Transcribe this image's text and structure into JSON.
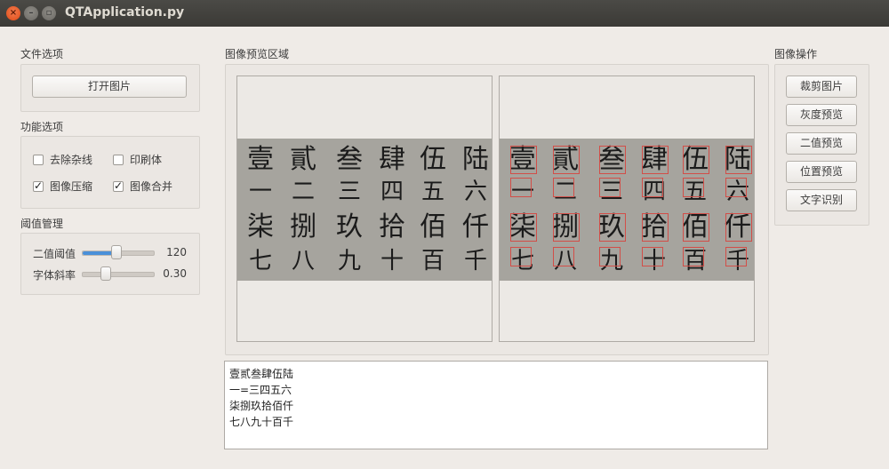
{
  "window": {
    "title": "QTApplication.py",
    "close_glyph": "×",
    "min_glyph": "–",
    "max_glyph": "▫"
  },
  "file_options": {
    "label": "文件选项",
    "open_button": "打开图片"
  },
  "function_options": {
    "label": "功能选项",
    "checkboxes": [
      {
        "label": "去除杂线",
        "checked": false
      },
      {
        "label": "印刷体",
        "checked": false
      },
      {
        "label": "图像压缩",
        "checked": true
      },
      {
        "label": "图像合并",
        "checked": true
      }
    ]
  },
  "threshold": {
    "label": "阈值管理",
    "sliders": [
      {
        "label": "二值阈值",
        "value_text": "120",
        "fraction": 0.47
      },
      {
        "label": "字体斜率",
        "value_text": "0.30",
        "fraction": 0.3
      }
    ]
  },
  "preview": {
    "label": "图像预览区域",
    "rows": [
      [
        "壹",
        "貳",
        "叁",
        "肆",
        "伍",
        "陆"
      ],
      [
        "一",
        "二",
        "三",
        "四",
        "五",
        "六"
      ],
      [
        "柒",
        "捌",
        "玖",
        "拾",
        "佰",
        "仟"
      ],
      [
        "七",
        "八",
        "九",
        "十",
        "百",
        "千"
      ]
    ]
  },
  "ocr_result": {
    "lines": [
      "壹贰叁肆伍陆",
      "一=三四五六",
      "柒捌玖拾佰仟",
      "七八九十百千"
    ]
  },
  "image_ops": {
    "label": "图像操作",
    "buttons": [
      "裁剪图片",
      "灰度预览",
      "二值预览",
      "位置预览",
      "文字识别"
    ]
  },
  "colors": {
    "titlebar": "#3b3a36",
    "close": "#df4b16",
    "accent": "#4a90d9",
    "detect_box": "#d24e48"
  }
}
